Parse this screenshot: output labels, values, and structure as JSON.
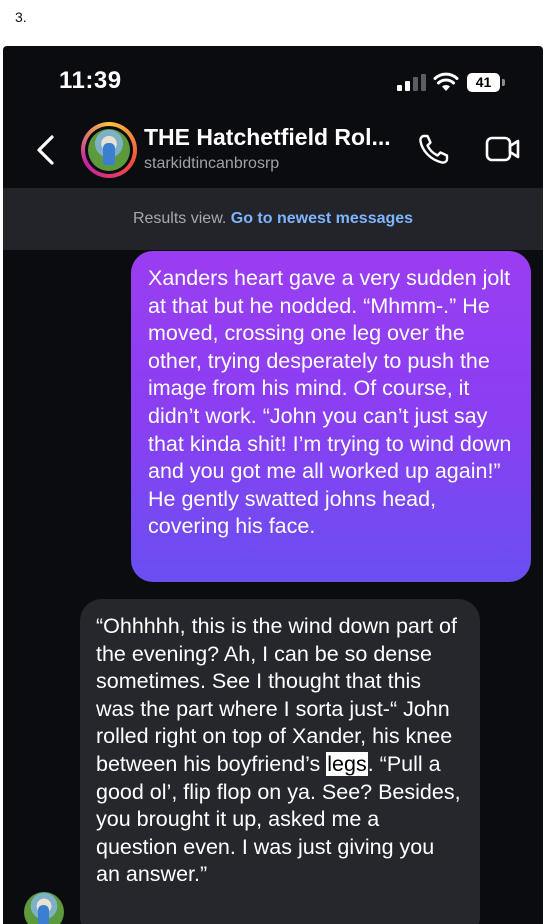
{
  "post_number": "3.",
  "status_bar": {
    "time": "11:39",
    "battery_level": "41"
  },
  "header": {
    "title": "THE Hatchetfield Rol...",
    "subtitle": "starkidtincanbrosrp",
    "icons": [
      "back-chevron-icon",
      "phone-icon",
      "video-camera-icon"
    ]
  },
  "results_bar": {
    "label": "Results view.",
    "link": "Go to newest messages"
  },
  "messages": [
    {
      "direction": "sent",
      "text": "Xanders heart gave a very sudden jolt at that but he nodded. “Mhmm-.” He moved, crossing one leg over the other, trying desperately to push the image from his mind. Of course, it didn’t work. “John you can’t just say that kinda shit! I’m trying to wind down and you got me all worked up again!” He gently swatted johns head, covering his face."
    },
    {
      "direction": "received",
      "text_before": "“Ohhhhh, this is the wind down part of the evening? Ah, I can be so dense sometimes. See I thought that this was the part where I sorta just-“ John rolled right on top of Xander, his knee between his boyfriend’s ",
      "highlight": "legs",
      "text_after": ". “Pull a good ol’, flip flop on ya. See? Besides, you brought it up, asked me a question even. I was just giving you an answer.”"
    }
  ],
  "colors": {
    "background": "#0b0c10",
    "sent_gradient_top": "#9b3df2",
    "sent_gradient_bottom": "#6a4ff0",
    "received_bubble": "#25272d",
    "link": "#7fb4ff"
  }
}
